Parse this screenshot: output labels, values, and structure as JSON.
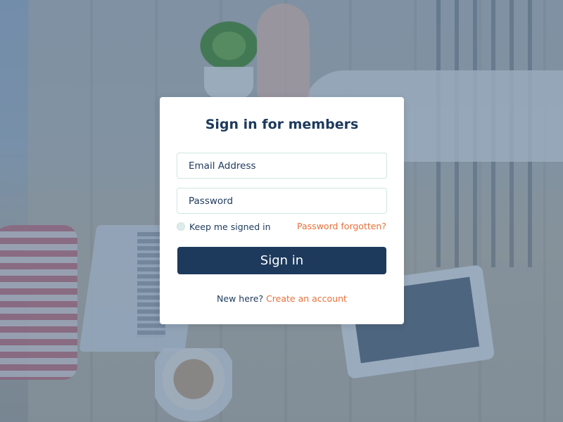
{
  "signin": {
    "title": "Sign in for members",
    "email_placeholder": "Email Address",
    "password_placeholder": "Password",
    "remember_label": "Keep me signed in",
    "forgot_label": "Password forgotten?",
    "button_label": "Sign in",
    "new_here_text": "New here?",
    "create_account_label": "Create an account"
  },
  "colors": {
    "primary": "#1d3a5c",
    "accent": "#e8713a",
    "field_border": "#cfe7e3"
  }
}
